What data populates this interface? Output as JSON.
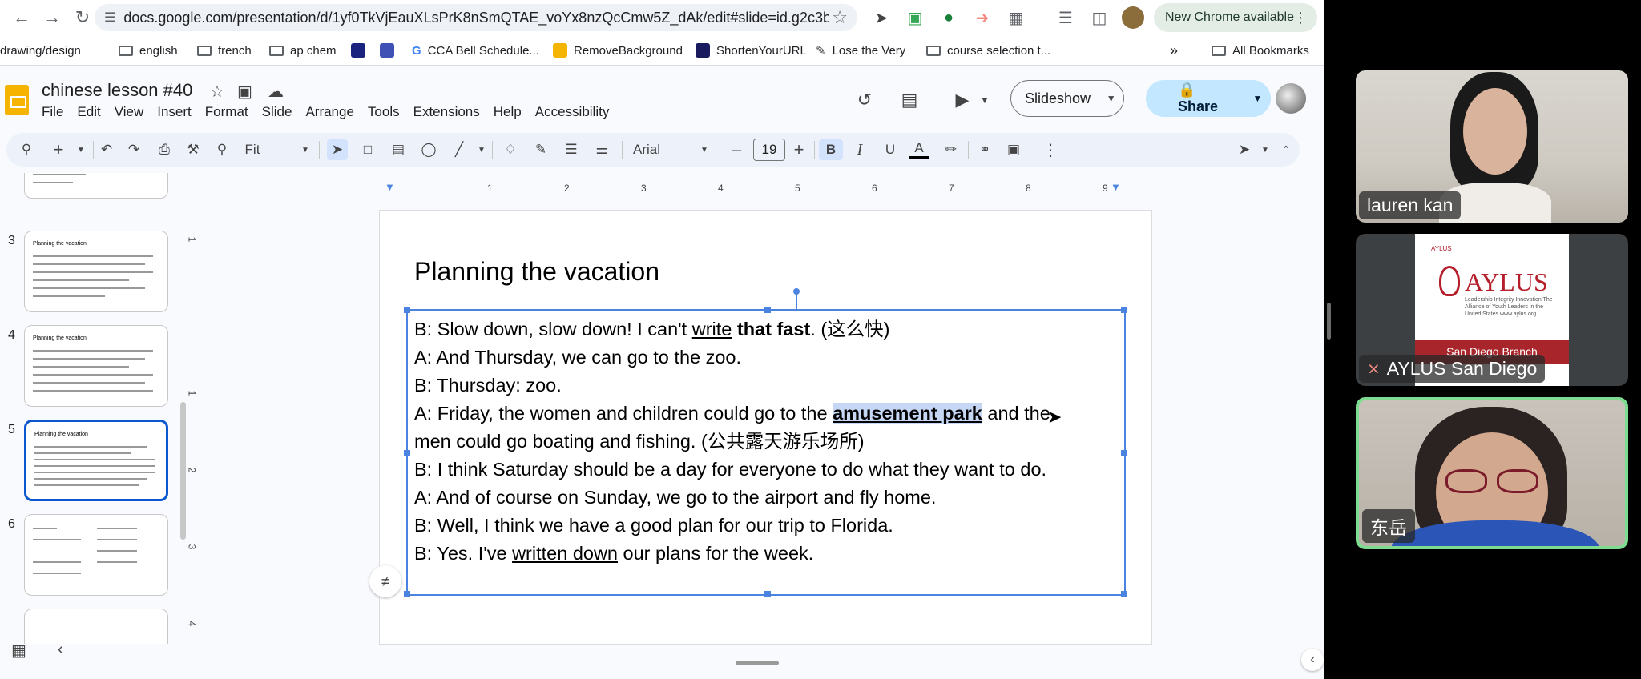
{
  "browser": {
    "url": "docs.google.com/presentation/d/1yf0TkVjEauXLsPrK8nSmQTAE_voYx8nzQcCmw5Z_dAk/edit#slide=id.g2c3b...",
    "new_chrome_label": "New Chrome available",
    "bookmarks": [
      "drawing/design",
      "english",
      "french",
      "ap chem",
      "CCA Bell Schedule...",
      "RemoveBackground",
      "ShortenYourURL",
      "Lose the Very",
      "course selection t...",
      "All Bookmarks"
    ]
  },
  "doc": {
    "title": "chinese lesson #40",
    "menu": [
      "File",
      "Edit",
      "View",
      "Insert",
      "Format",
      "Slide",
      "Arrange",
      "Tools",
      "Extensions",
      "Help",
      "Accessibility"
    ],
    "slideshow_label": "Slideshow",
    "share_label": "Share"
  },
  "toolbar": {
    "zoom": "Fit",
    "font": "Arial",
    "font_size": "19",
    "bold": "B",
    "italic": "I",
    "underline": "U",
    "text_color": "A"
  },
  "filmstrip": {
    "slide_numbers": [
      "3",
      "4",
      "5",
      "6"
    ],
    "thumb_title": "Planning the vacation"
  },
  "ruler": {
    "ticks": [
      "1",
      "2",
      "3",
      "4",
      "5",
      "6",
      "7",
      "8",
      "9"
    ],
    "vticks": [
      "1",
      "1",
      "2",
      "3",
      "4"
    ]
  },
  "slide": {
    "title": "Planning the vacation",
    "lines": [
      {
        "a": "B: Slow down, slow down! I can't ",
        "u": "write",
        "b": "that fast",
        "c": ". (这么快)"
      },
      {
        "t": "A: And Thursday, we can go to the zoo."
      },
      {
        "t": "B: Thursday: zoo."
      },
      {
        "a": "A: Friday, the women and children could go to the ",
        "hl": "amusement park",
        "c": " and the"
      },
      {
        "t": "men could go boating and fishing. (公共露天游乐场所)"
      },
      {
        "t": "B: I think Saturday should be a day for everyone to do what they want to do."
      },
      {
        "t": "A: And of course on Sunday, we go to the airport and fly home."
      },
      {
        "t": "B: Well, I think we have a good plan for our trip to Florida."
      },
      {
        "a": "B: Yes. I've ",
        "u": "written down",
        "c": " our plans for the week."
      }
    ]
  },
  "meeting": {
    "participants": [
      {
        "name": "lauren kan"
      },
      {
        "name": "AYLUS San Diego",
        "muted": true
      },
      {
        "name": "东岳"
      }
    ],
    "poster": {
      "logo_text": "AYLUS",
      "small": "AYLUS",
      "tagline": "Leadership Integrity Innovation The Alliance of Youth Leaders in the United States www.aylus.org",
      "branch": "San Diego Branch"
    }
  },
  "colors": {
    "accent": "#0b57d0",
    "share_bg": "#c2e7ff",
    "selection": "#4a84e0",
    "speaker_border": "#7ddc8f"
  }
}
